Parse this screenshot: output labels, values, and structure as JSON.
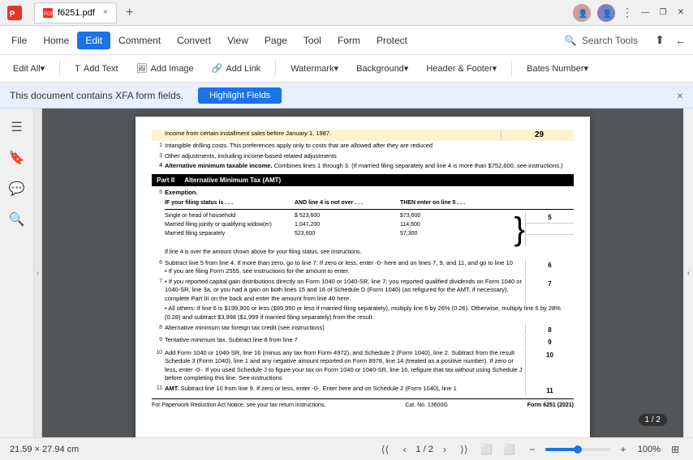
{
  "titleBar": {
    "appName": "f6251.pdf",
    "tabLabel": "f6251.pdf",
    "closeTab": "×",
    "newTab": "+",
    "threeDots": "⋮",
    "minimize": "—",
    "restore": "❐",
    "close": "✕"
  },
  "menuBar": {
    "file": "File",
    "home": "Home",
    "edit": "Edit",
    "comment": "Comment",
    "convert": "Convert",
    "view": "View",
    "page": "Page",
    "tool": "Tool",
    "form": "Form",
    "protect": "Protect",
    "searchTools": "Search Tools"
  },
  "toolbar": {
    "editAll": "Edit All▾",
    "addText": "Add Text",
    "addImage": "Add Image",
    "addLink": "Add Link",
    "watermark": "Watermark▾",
    "background": "Background▾",
    "headerFooter": "Header & Footer▾",
    "batesNumber": "Bates Number▾"
  },
  "xfaBar": {
    "message": "This document contains XFA form fields.",
    "highlightBtn": "Highlight Fields",
    "close": "×"
  },
  "sidebar": {
    "icons": [
      "☰",
      "🔖",
      "💬",
      "🔍"
    ]
  },
  "pdfContent": {
    "lineHighlight": "Income from certain installment sales before January 1, 1987.",
    "line1": "Intangible drilling costs. This preferences apply only to costs that are allowed after they are reduced",
    "line3": "Other adjustments, including income-based related adjustments",
    "line4Label": "Alternative minimum taxable income.",
    "line4Text": "Combines lines 1 through 3. (If married filing separately and line 4 is more than $752,600, see instructions.)",
    "partII": "Part II",
    "partIITitle": "Alternative Minimum Tax (AMT)",
    "line5": "Exemption.",
    "tableHeaders": [
      "IF your filing status is . . .",
      "AND line 4 is not over . . .",
      "THEN enter on line 5 . . ."
    ],
    "tableRows": [
      [
        "Single or head of household",
        "$   523,600",
        "$73,600"
      ],
      [
        "Married filing jointly or qualifying widow(er)",
        "1,047,200",
        "114,600"
      ],
      [
        "Married filing separately",
        "523,600",
        "57,300"
      ]
    ],
    "ifLine4Over": "If line 4 is over the amount shown above for your filing status, see instructions.",
    "line6": "Subtract line 5 from line 4. If more than zero, go to line 7. If zero or less, enter -0- here and on lines 7, 9, and 11, and go to line 10",
    "line6sub": "• If you are filing Form 2555, see instructions for the amount to enter.",
    "line7": "• If you reported capital gain distributions directly on Form 1040 or 1040-SR, line 7; you reported qualified dividends on Form 1040 or 1040-SR, line 3a, or you had a gain on both lines 15 and 16 of Schedule D (Form 1040) (as refigured for the AMT, if necessary), complete Part III on the back and enter the amount from line 40 here.",
    "line7allOthers": "• All others: If line 6 is $199,900 or less ($99,950 or less if married filing separately), multiply line 6 by 26% (0.26). Otherwise, multiply line 6 by 28% (0.28) and subtract $3,998 ($1,999 if married filing separately) from the result.",
    "line8": "Alternative minimum tax foreign tax credit (see instructions)",
    "line9": "Tentative minimum tax. Subtract line 8 from line 7",
    "line10": "Add Form 1040 or 1040-SR, line 16 (minus any tax from Form 4972), and Schedule 2 (Form 1040), line 2. Subtract from the result Schedule 3 (Form 1040), line 1 and any negative amount reported on Form 8978, line 14 (treated as a positive number). If zero or less, enter -0-. If you used Schedule J to figure your tax on Form 1040 or 1040-SR, line 16, refigure that tax without using Schedule J before completing this line. See instructions",
    "line11": "AMT.",
    "line11text": "Subtract line 10 from line 9. If zero or less, enter -0-. Enter here and on Schedule 2 (Form 1040), line 1",
    "footerLeft": "For Paperwork Reduction Act Notice, see your tax return instructions.",
    "footerCat": "Cat. No. 13600G",
    "footerForm": "Form 6251 (2021)"
  },
  "statusBar": {
    "dimensions": "21.59 × 27.94 cm",
    "pageDisplay": "1 / 2",
    "zoomLevel": "100%"
  },
  "pageBadge": "1 / 2"
}
